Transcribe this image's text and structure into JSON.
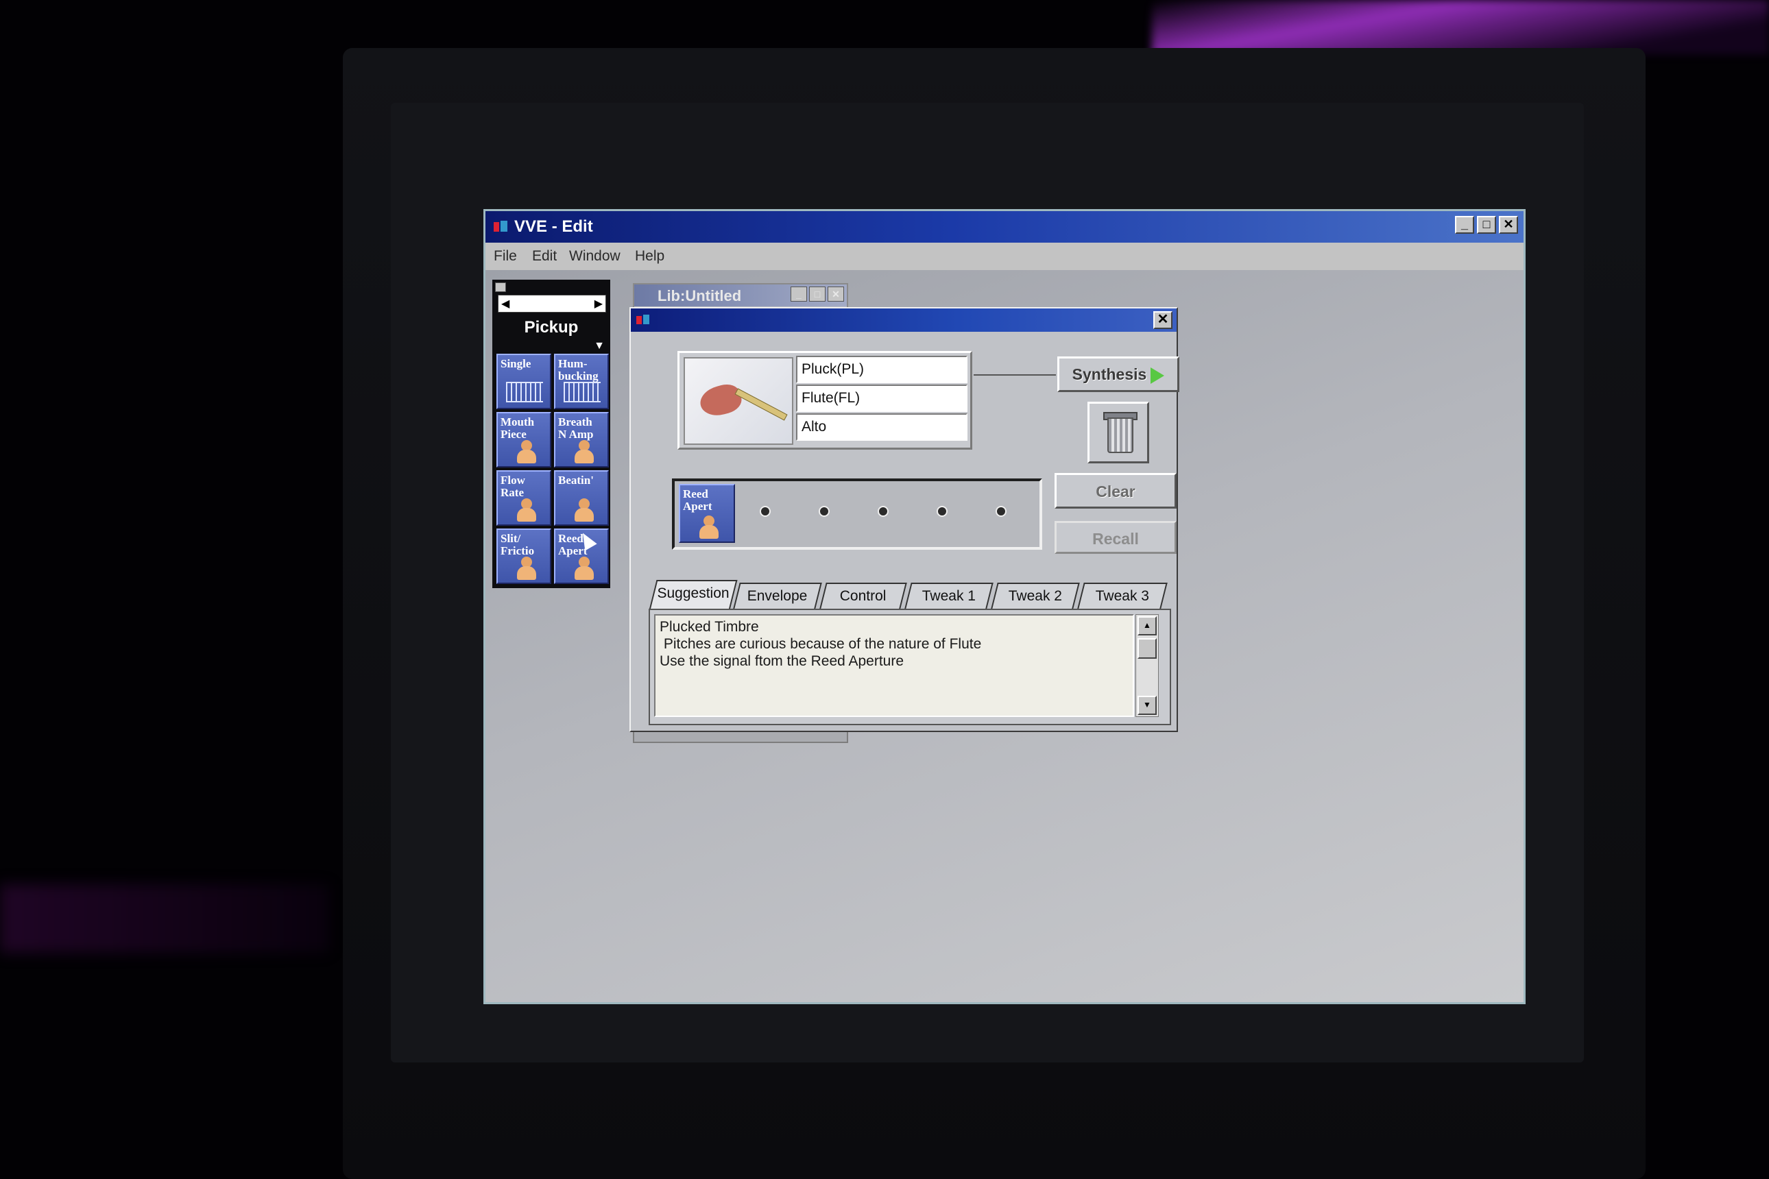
{
  "window": {
    "title": "VVE - Edit",
    "controls": [
      "_",
      "□",
      "✕"
    ]
  },
  "menu": {
    "file": "File",
    "edit": "Edit",
    "window": "Window",
    "help": "Help"
  },
  "palette": {
    "title": "Pickup",
    "tiles": [
      {
        "label": "Single",
        "icon": "pickup-bars-icon"
      },
      {
        "label": "Hum-\nbucking",
        "icon": "pickup-bars-icon"
      },
      {
        "label": "Mouth\nPiece",
        "icon": "figure-icon"
      },
      {
        "label": "Breath\nN Amp",
        "icon": "figure-icon"
      },
      {
        "label": "Flow\nRate",
        "icon": "figure-icon"
      },
      {
        "label": "Beatin'",
        "icon": "figure-icon"
      },
      {
        "label": "Slit/\nFrictio",
        "icon": "figure-icon"
      },
      {
        "label": "Reed\nApert",
        "icon": "figure-icon"
      }
    ]
  },
  "lib_window": {
    "title": "Lib:Untitled"
  },
  "dialog": {
    "instrument": {
      "rows": [
        "Pluck(PL)",
        "Flute(FL)",
        "Alto"
      ]
    },
    "buttons": {
      "synthesis": "Synthesis",
      "clear": "Clear",
      "recall": "Recall"
    },
    "slot_tile": "Reed\nApert",
    "tabs": [
      "Suggestion",
      "Envelope",
      "Control",
      "Tweak 1",
      "Tweak 2",
      "Tweak 3"
    ],
    "active_tab": "Suggestion",
    "suggestion_lines": [
      "Plucked Timbre",
      " Pitches are curious because of the nature of Flute",
      "Use the signal ftom the Reed Aperture"
    ]
  },
  "colors": {
    "title_gradient_start": "#0b1a6e",
    "title_gradient_end": "#4b73c9",
    "tile_blue": "#4b62b8",
    "synth_arrow": "#58c843",
    "desktop": "#b4b6bc"
  }
}
